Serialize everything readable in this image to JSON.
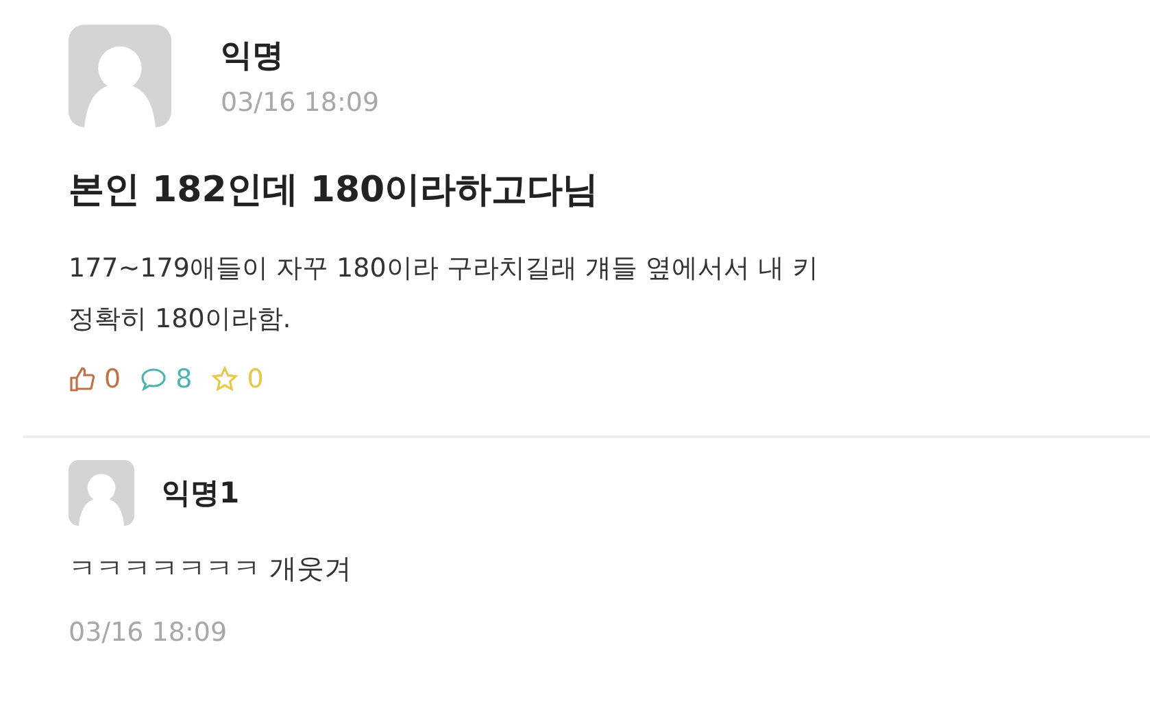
{
  "post": {
    "author": "익명",
    "time": "03/16 18:09",
    "title": "본인 182인데 180이라하고다님",
    "body_lines": [
      "177~179애들이 자꾸 180이라 구라치길래 걔들 옆에서서 내 키",
      "정확히 180이라함."
    ],
    "stats": [
      {
        "kind": "like",
        "count": "0",
        "color": "#c0704a"
      },
      {
        "kind": "comment",
        "count": "8",
        "color": "#4fb3b3"
      },
      {
        "kind": "scrap",
        "count": "0",
        "color": "#e6c84a"
      }
    ]
  },
  "comments": [
    {
      "author": "익명1",
      "text": "ㅋㅋㅋㅋㅋㅋㅋ 개웃겨",
      "time": "03/16 18:09"
    }
  ]
}
